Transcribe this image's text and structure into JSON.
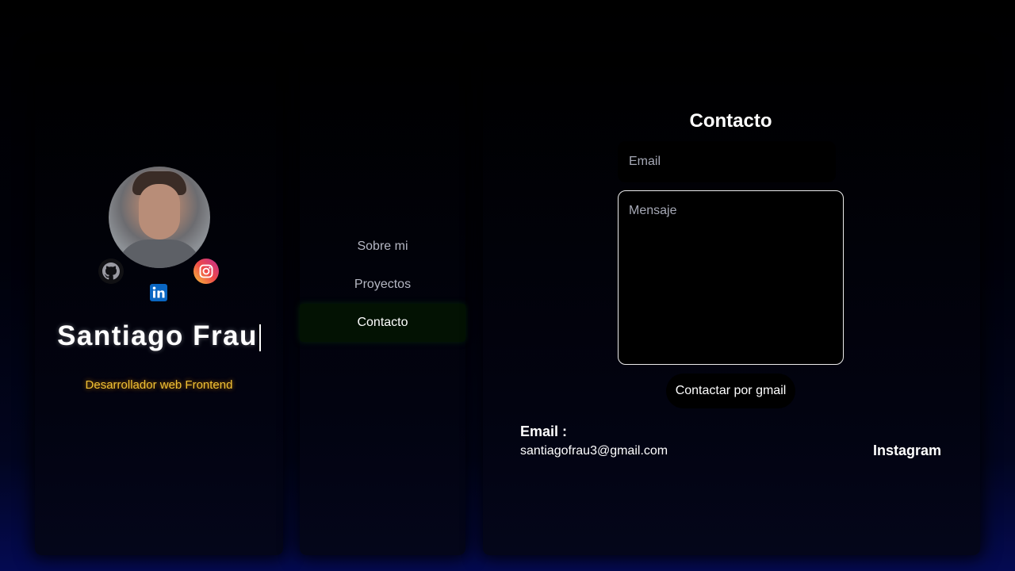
{
  "profile": {
    "name": "Santiago Frau",
    "role": "Desarrollador web Frontend",
    "social": {
      "github": "github-icon",
      "instagram": "instagram-icon",
      "linkedin": "linkedin-icon"
    }
  },
  "nav": {
    "items": [
      {
        "label": "Sobre mi",
        "active": false
      },
      {
        "label": "Proyectos",
        "active": false
      },
      {
        "label": "Contacto",
        "active": true
      }
    ]
  },
  "contact": {
    "title": "Contacto",
    "email_placeholder": "Email",
    "message_placeholder": "Mensaje",
    "send_label": "Contactar por gmail",
    "email_label": "Email :",
    "email_value": "santiagofrau3@gmail.com",
    "instagram_label": "Instagram"
  },
  "colors": {
    "role_text": "#f1c235",
    "nav_active_bg": "#031203",
    "background_bottom": "#040a52"
  }
}
